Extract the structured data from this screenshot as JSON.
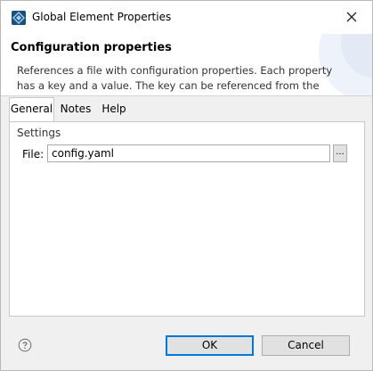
{
  "window": {
    "title": "Global Element Properties",
    "icon": "mule-app-icon",
    "close_icon": "close-icon"
  },
  "banner": {
    "title": "Configuration properties",
    "description": "References a file with configuration properties. Each property has a key and a value. The key can be referenced from the mule"
  },
  "tabs": [
    {
      "label": "General",
      "active": true
    },
    {
      "label": "Notes",
      "active": false
    },
    {
      "label": "Help",
      "active": false
    }
  ],
  "settings": {
    "legend": "Settings",
    "file_label": "File:",
    "file_value": "config.yaml",
    "browse_label": "..."
  },
  "footer": {
    "help_icon": "help-icon",
    "ok_label": "OK",
    "cancel_label": "Cancel"
  },
  "colors": {
    "accent": "#0078d7",
    "banner_deco": "#e8eef8"
  }
}
